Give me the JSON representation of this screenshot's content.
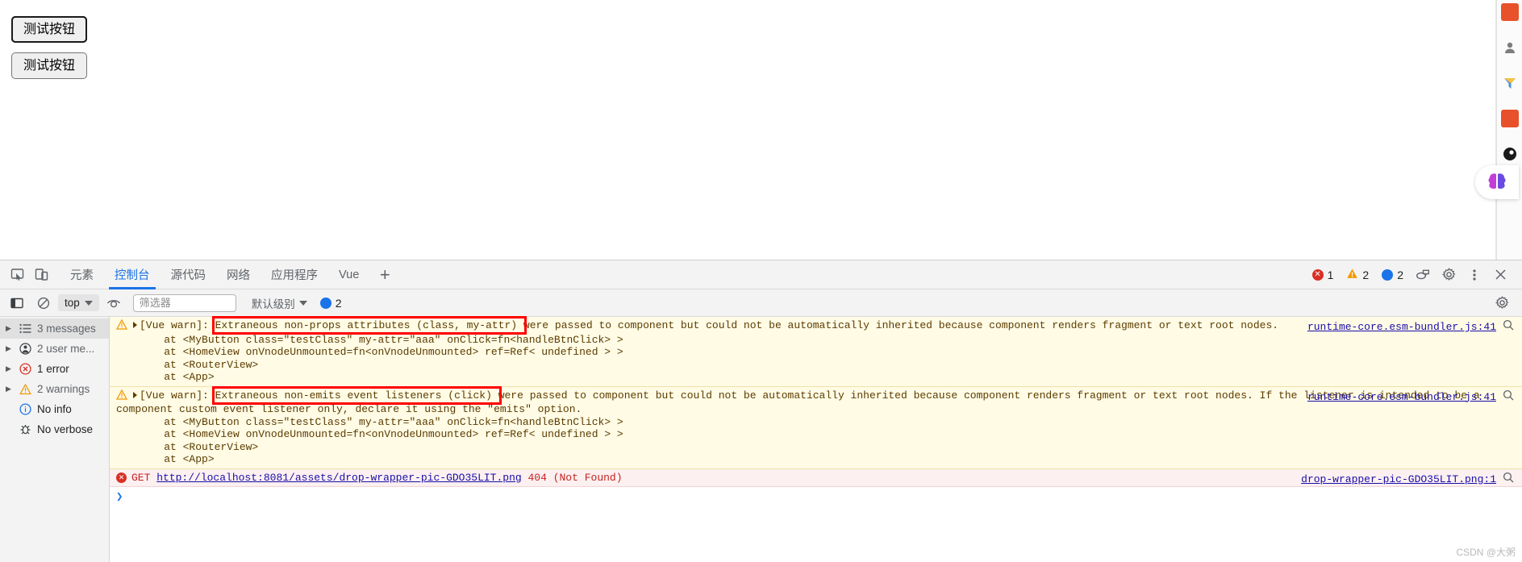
{
  "page": {
    "buttons": [
      {
        "label": "测试按钮",
        "focused": true
      },
      {
        "label": "测试按钮",
        "focused": false
      }
    ]
  },
  "right_rail": {
    "icons": [
      "extension-orange-icon",
      "person-gray-icon",
      "funnel-blue-icon",
      "shield-red-icon",
      "record-black-icon",
      "info-blue-icon"
    ],
    "brain_chip": "brain-icon"
  },
  "devtools": {
    "inspect_icon": "inspect-element-icon",
    "device_icon": "device-toolbar-icon",
    "tabs": [
      {
        "label": "元素",
        "active": false
      },
      {
        "label": "控制台",
        "active": true
      },
      {
        "label": "源代码",
        "active": false
      },
      {
        "label": "网络",
        "active": false
      },
      {
        "label": "应用程序",
        "active": false
      },
      {
        "label": "Vue",
        "active": false
      }
    ],
    "add_tab_label": "+",
    "status": {
      "error_count": "1",
      "warning_count": "2",
      "message_count": "2"
    },
    "settings_icon": "gear-icon",
    "more_icon": "kebab-menu-icon",
    "close_icon": "close-icon",
    "inspect_console_icon": "console-inspect-icon"
  },
  "filterbar": {
    "sidebar_toggle_icon": "show-console-sidebar-icon",
    "clear_icon": "clear-console-icon",
    "context": "top",
    "eye_icon": "live-expression-icon",
    "filter_placeholder": "筛选器",
    "filter_value": "",
    "level": "默认级别",
    "issues_count": "2",
    "settings_icon": "console-settings-icon"
  },
  "sidebar": {
    "items": [
      {
        "label": "3 messages",
        "icon": "list-icon",
        "expandable": true,
        "selected": true,
        "dark": false
      },
      {
        "label": "2 user me...",
        "icon": "user-icon",
        "expandable": true,
        "selected": false,
        "dark": false
      },
      {
        "label": "1 error",
        "icon": "error-circle-icon",
        "expandable": true,
        "selected": false,
        "dark": true
      },
      {
        "label": "2 warnings",
        "icon": "warning-triangle-icon",
        "expandable": true,
        "selected": false,
        "dark": false
      },
      {
        "label": "No info",
        "icon": "info-circle-icon",
        "expandable": false,
        "selected": false,
        "dark": true
      },
      {
        "label": "No verbose",
        "icon": "bug-icon",
        "expandable": false,
        "selected": false,
        "dark": true
      }
    ]
  },
  "console": {
    "entries": [
      {
        "type": "warning",
        "prefix": "[Vue warn]: ",
        "highlight": "Extraneous non-props attributes (class, my-attr) ",
        "rest": "were passed to component but could not be automatically inherited because component renders fragment or text root nodes.",
        "source": "runtime-core.esm-bundler.js:41",
        "stack": [
          "    at <MyButton class=\"testClass\" my-attr=\"aaa\" onClick=fn<handleBtnClick> >",
          "    at <HomeView onVnodeUnmounted=fn<onVnodeUnmounted> ref=Ref< undefined > >",
          "    at <RouterView>",
          "    at <App>"
        ]
      },
      {
        "type": "warning",
        "prefix": "[Vue warn]: ",
        "highlight": "Extraneous non-emits event listeners (click) ",
        "rest": "were passed to component but could not be automatically inherited because component renders fragment or text root nodes. If the listener is intended to be a component custom event listener only, declare it using the \"emits\" option.",
        "source": "runtime-core.esm-bundler.js:41",
        "stack": [
          "    at <MyButton class=\"testClass\" my-attr=\"aaa\" onClick=fn<handleBtnClick> >",
          "    at <HomeView onVnodeUnmounted=fn<onVnodeUnmounted> ref=Ref< undefined > >",
          "    at <RouterView>",
          "    at <App>"
        ]
      },
      {
        "type": "error",
        "method": "GET ",
        "url": "http://localhost:8081/assets/drop-wrapper-pic-GDO35LIT.png",
        "status": " 404 (Not Found)",
        "source": "drop-wrapper-pic-GDO35LIT.png:1"
      }
    ],
    "prompt_symbol": "❯"
  },
  "watermark": "CSDN @大粥",
  "colors": {
    "accent": "#1a73e8",
    "warning_bg": "#fffbe5",
    "warning_text": "#5c3c00",
    "error_bg": "#fcf0f0",
    "error_text": "#c5221f",
    "link": "#1a0dab",
    "annotation": "#ff0000"
  }
}
